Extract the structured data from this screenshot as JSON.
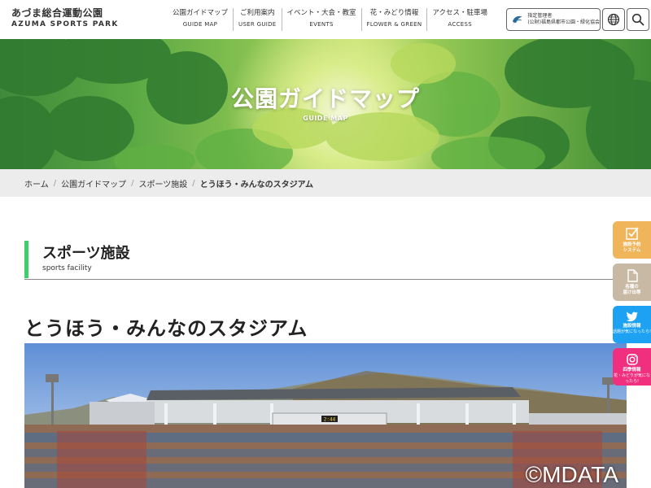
{
  "header": {
    "logo_jp": "あづま総合運動公園",
    "logo_en": "AZUMA SPORTS PARK",
    "nav": [
      {
        "jp": "公園ガイドマップ",
        "en": "GUIDE MAP"
      },
      {
        "jp": "ご利用案内",
        "en": "USER GUIDE"
      },
      {
        "jp": "イベント・大会・教室",
        "en": "EVENTS"
      },
      {
        "jp": "花・みどり情報",
        "en": "FLOWER & GREEN"
      },
      {
        "jp": "アクセス・駐車場",
        "en": "ACCESS"
      }
    ],
    "manager_line1": "指定管理者",
    "manager_line2": "(公財)福島県都市公園・緑化協会",
    "icons": {
      "language": "globe-icon",
      "search": "search-icon"
    }
  },
  "hero": {
    "title": "公園ガイドマップ",
    "subtitle": "GUIDE MAP"
  },
  "breadcrumb": {
    "home": "ホーム",
    "guide": "公園ガイドマップ",
    "category": "スポーツ施設",
    "current": "とうほう・みんなのスタジアム"
  },
  "section": {
    "title": "スポーツ施設",
    "subtitle": "sports facility",
    "accent_color": "#3fcf6a"
  },
  "page_heading": "とうほう・みんなのスタジアム",
  "photo": {
    "scoreboard": "2:44",
    "watermark": "©MDATA"
  },
  "side_tabs": [
    {
      "label1": "施設予約",
      "label2": "システム",
      "color": "#f0b45a",
      "icon": "checkbox-icon"
    },
    {
      "label1": "各種の",
      "label2": "届け出等",
      "color": "#c8b9a4",
      "icon": "document-icon"
    },
    {
      "label1": "施設情報",
      "label2": "話題が気になったら!",
      "color": "#1da1f2",
      "icon": "twitter-icon"
    },
    {
      "label1": "四季情報",
      "label2": "花・みどりが気になったら!",
      "color": "#f0307f",
      "icon": "instagram-icon"
    }
  ]
}
